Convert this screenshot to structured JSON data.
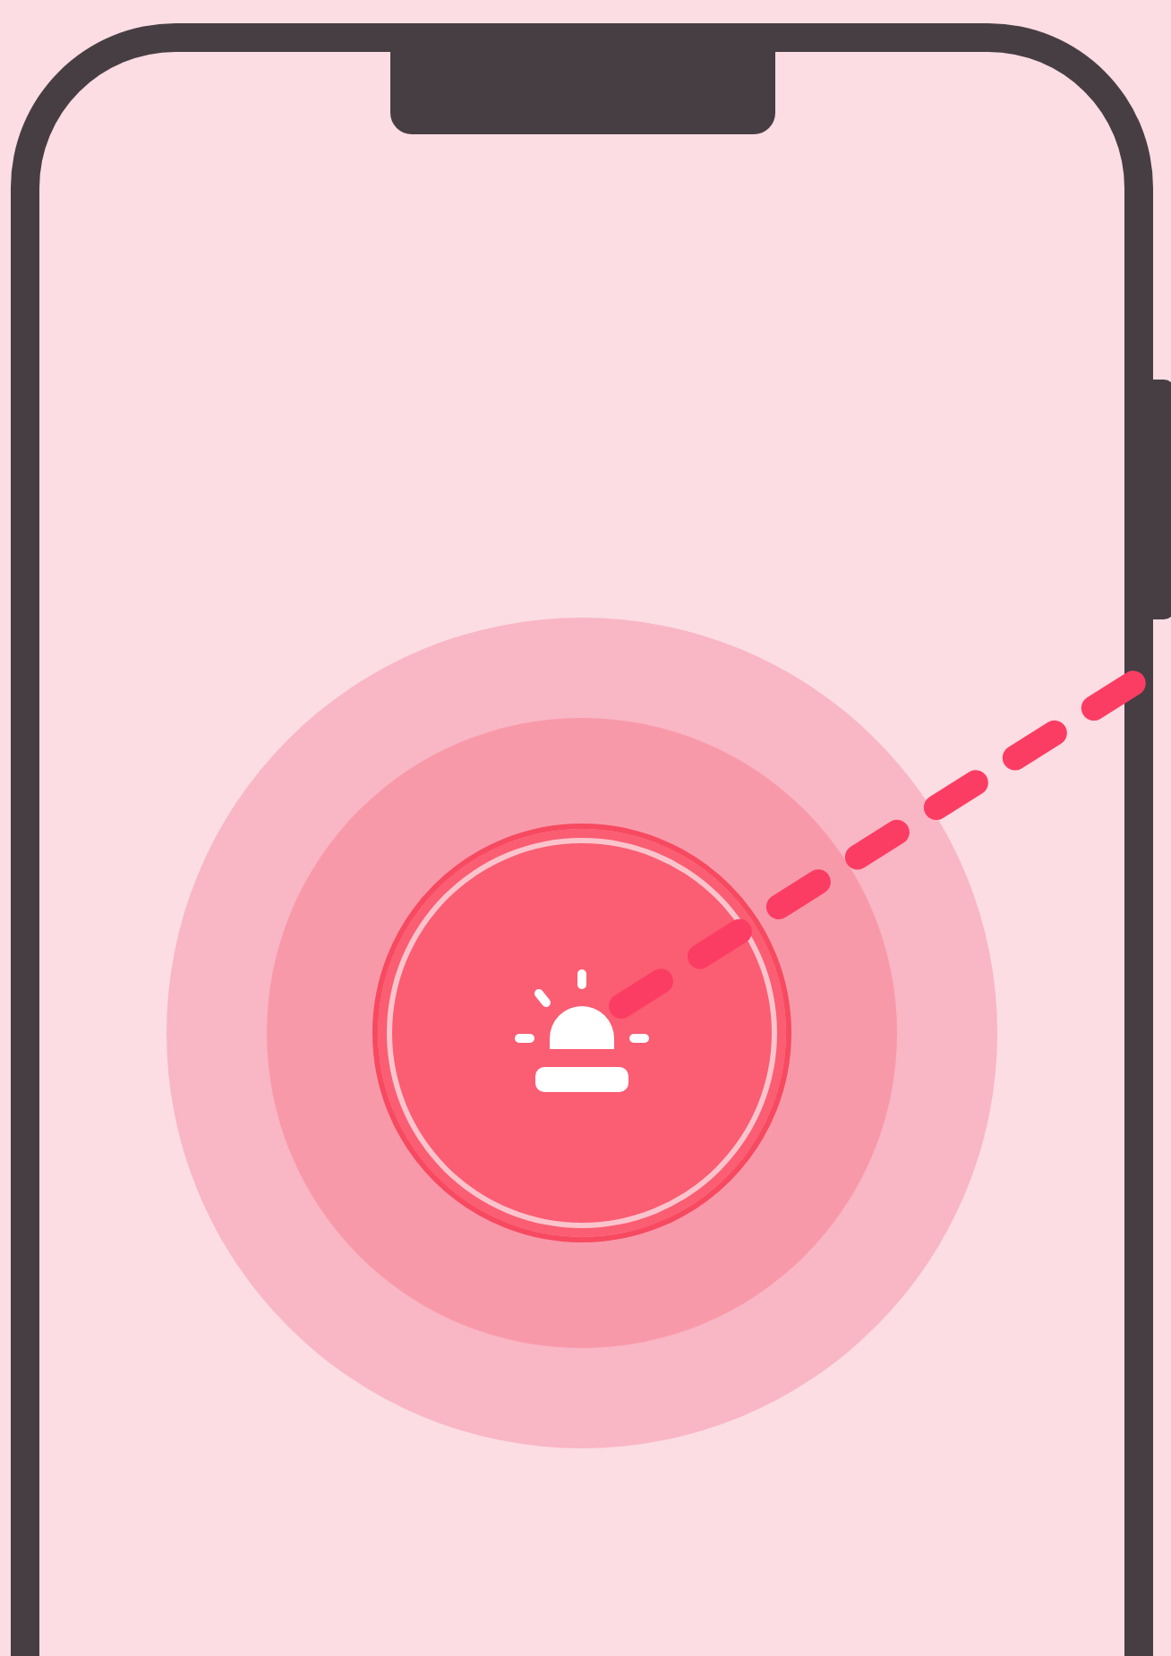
{
  "phone": {
    "alarm_button": {
      "kind": "siren",
      "pulsing": true
    }
  }
}
